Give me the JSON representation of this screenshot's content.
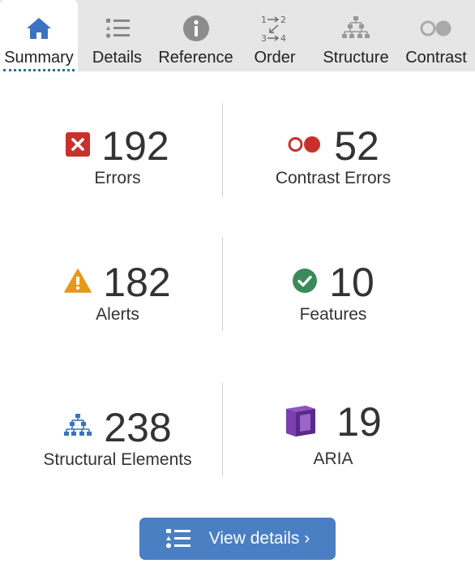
{
  "tabs": [
    {
      "label": "Summary",
      "icon": "home-icon"
    },
    {
      "label": "Details",
      "icon": "list-icon"
    },
    {
      "label": "Reference",
      "icon": "info-icon"
    },
    {
      "label": "Order",
      "icon": "order-icon"
    },
    {
      "label": "Structure",
      "icon": "structure-icon"
    },
    {
      "label": "Contrast",
      "icon": "contrast-icon"
    }
  ],
  "active_tab": "Summary",
  "summary": [
    {
      "count": "192",
      "label": "Errors",
      "icon": "error-icon",
      "color": "#c9302c"
    },
    {
      "count": "52",
      "label": "Contrast Errors",
      "icon": "contrast-error-icon",
      "color": "#c9302c"
    },
    {
      "count": "182",
      "label": "Alerts",
      "icon": "alert-icon",
      "color": "#e8971d"
    },
    {
      "count": "10",
      "label": "Features",
      "icon": "feature-icon",
      "color": "#3a8a5a"
    },
    {
      "count": "238",
      "label": "Structural Elements",
      "icon": "structure-icon",
      "color": "#3b73c2"
    },
    {
      "count": "19",
      "label": "ARIA",
      "icon": "aria-icon",
      "color": "#5b2a86"
    }
  ],
  "button": {
    "label": "View details ›",
    "color": "#4a7fc4"
  }
}
